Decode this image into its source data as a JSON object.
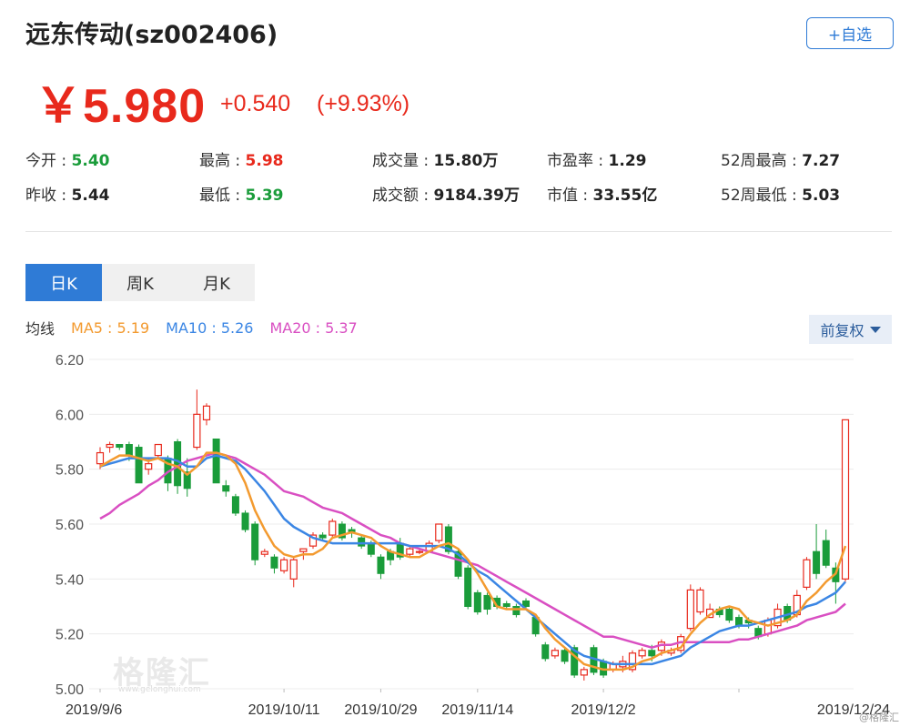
{
  "header": {
    "title": "远东传动(sz002406)",
    "add_button": "+自选"
  },
  "quote": {
    "price": "￥5.980",
    "change": "+0.540",
    "change_pct": "(+9.93%)"
  },
  "stats": {
    "open_label": "今开 : ",
    "open_value": "5.40",
    "prev_close_label": "昨收 : ",
    "prev_close_value": "5.44",
    "high_label": "最高 : ",
    "high_value": "5.98",
    "low_label": "最低 : ",
    "low_value": "5.39",
    "volume_label": "成交量 : ",
    "volume_value": "15.80万",
    "turnover_label": "成交额 : ",
    "turnover_value": "9184.39万",
    "pe_label": "市盈率 : ",
    "pe_value": "1.29",
    "mcap_label": "市值 : ",
    "mcap_value": "33.55亿",
    "wk52_high_label": "52周最高 : ",
    "wk52_high_value": "7.27",
    "wk52_low_label": "52周最低 : ",
    "wk52_low_value": "5.03"
  },
  "tabs": [
    {
      "label": "日K",
      "active": true
    },
    {
      "label": "周K",
      "active": false
    },
    {
      "label": "月K",
      "active": false
    }
  ],
  "ma_legend": {
    "label": "均线",
    "ma5": "MA5 : 5.19",
    "ma10": "MA10 : 5.26",
    "ma20": "MA20 : 5.37"
  },
  "adjust_button": "前复权",
  "watermark": {
    "text": "格隆汇",
    "url": "www.gelonghui.com",
    "credit": "@格隆汇"
  },
  "colors": {
    "up": "#e8291c",
    "down": "#1a9c3a",
    "accent": "#2f7bd6",
    "ma5": "#f39a2f",
    "ma10": "#3b86e4",
    "ma20": "#d94fc2"
  },
  "chart_data": {
    "type": "candlestick",
    "ylim": [
      5.0,
      6.2
    ],
    "y_ticks": [
      "6.20",
      "6.00",
      "5.80",
      "5.60",
      "5.40",
      "5.20",
      "5.00"
    ],
    "x_ticks": [
      "2019/9/6",
      "2019/10/11",
      "2019/10/29",
      "2019/11/14",
      "2019/12/2",
      "2019/12/24"
    ],
    "x_tick_index": [
      0,
      19,
      29,
      39,
      52,
      66
    ],
    "candles": [
      [
        5.82,
        5.86,
        5.88,
        5.8
      ],
      [
        5.88,
        5.89,
        5.9,
        5.86
      ],
      [
        5.89,
        5.88,
        5.89,
        5.87
      ],
      [
        5.89,
        5.85,
        5.9,
        5.83
      ],
      [
        5.88,
        5.75,
        5.89,
        5.75
      ],
      [
        5.8,
        5.82,
        5.84,
        5.78
      ],
      [
        5.85,
        5.89,
        5.89,
        5.84
      ],
      [
        5.84,
        5.75,
        5.85,
        5.72
      ],
      [
        5.9,
        5.74,
        5.91,
        5.71
      ],
      [
        5.79,
        5.73,
        5.84,
        5.7
      ],
      [
        5.88,
        6.0,
        6.09,
        5.87
      ],
      [
        5.98,
        6.03,
        6.04,
        5.96
      ],
      [
        5.91,
        5.75,
        5.91,
        5.75
      ],
      [
        5.74,
        5.72,
        5.76,
        5.7
      ],
      [
        5.7,
        5.64,
        5.71,
        5.63
      ],
      [
        5.64,
        5.58,
        5.65,
        5.57
      ],
      [
        5.6,
        5.47,
        5.61,
        5.45
      ],
      [
        5.49,
        5.5,
        5.51,
        5.48
      ],
      [
        5.48,
        5.44,
        5.49,
        5.42
      ],
      [
        5.43,
        5.47,
        5.48,
        5.42
      ],
      [
        5.4,
        5.47,
        5.48,
        5.37
      ],
      [
        5.5,
        5.51,
        5.51,
        5.47
      ],
      [
        5.52,
        5.56,
        5.57,
        5.51
      ],
      [
        5.56,
        5.55,
        5.57,
        5.54
      ],
      [
        5.56,
        5.61,
        5.62,
        5.55
      ],
      [
        5.6,
        5.55,
        5.61,
        5.54
      ],
      [
        5.58,
        5.57,
        5.59,
        5.55
      ],
      [
        5.55,
        5.52,
        5.56,
        5.51
      ],
      [
        5.53,
        5.49,
        5.54,
        5.48
      ],
      [
        5.48,
        5.42,
        5.49,
        5.4
      ],
      [
        5.5,
        5.47,
        5.51,
        5.45
      ],
      [
        5.53,
        5.48,
        5.55,
        5.47
      ],
      [
        5.49,
        5.51,
        5.52,
        5.48
      ],
      [
        5.5,
        5.5,
        5.51,
        5.49
      ],
      [
        5.5,
        5.53,
        5.54,
        5.5
      ],
      [
        5.54,
        5.6,
        5.6,
        5.53
      ],
      [
        5.59,
        5.5,
        5.6,
        5.49
      ],
      [
        5.5,
        5.41,
        5.51,
        5.4
      ],
      [
        5.44,
        5.3,
        5.45,
        5.29
      ],
      [
        5.35,
        5.28,
        5.36,
        5.27
      ],
      [
        5.34,
        5.29,
        5.35,
        5.27
      ],
      [
        5.33,
        5.3,
        5.34,
        5.29
      ],
      [
        5.31,
        5.3,
        5.32,
        5.29
      ],
      [
        5.3,
        5.27,
        5.31,
        5.26
      ],
      [
        5.32,
        5.3,
        5.33,
        5.29
      ],
      [
        5.26,
        5.2,
        5.27,
        5.19
      ],
      [
        5.16,
        5.11,
        5.17,
        5.1
      ],
      [
        5.12,
        5.14,
        5.15,
        5.11
      ],
      [
        5.14,
        5.1,
        5.15,
        5.09
      ],
      [
        5.15,
        5.05,
        5.16,
        5.04
      ],
      [
        5.05,
        5.07,
        5.08,
        5.03
      ],
      [
        5.15,
        5.06,
        5.16,
        5.05
      ],
      [
        5.1,
        5.05,
        5.11,
        5.04
      ],
      [
        5.07,
        5.09,
        5.1,
        5.06
      ],
      [
        5.08,
        5.1,
        5.12,
        5.06
      ],
      [
        5.07,
        5.13,
        5.14,
        5.06
      ],
      [
        5.12,
        5.14,
        5.15,
        5.11
      ],
      [
        5.14,
        5.12,
        5.16,
        5.1
      ],
      [
        5.14,
        5.17,
        5.18,
        5.12
      ],
      [
        5.13,
        5.14,
        5.15,
        5.12
      ],
      [
        5.14,
        5.19,
        5.2,
        5.13
      ],
      [
        5.22,
        5.36,
        5.38,
        5.21
      ],
      [
        5.28,
        5.36,
        5.37,
        5.27
      ],
      [
        5.26,
        5.29,
        5.31,
        5.26
      ],
      [
        5.29,
        5.27,
        5.3,
        5.26
      ],
      [
        5.29,
        5.25,
        5.3,
        5.24
      ],
      [
        5.26,
        5.23,
        5.27,
        5.22
      ],
      [
        5.25,
        5.24,
        5.26,
        5.22
      ],
      [
        5.22,
        5.19,
        5.23,
        5.18
      ],
      [
        5.2,
        5.25,
        5.26,
        5.19
      ],
      [
        5.23,
        5.29,
        5.31,
        5.22
      ],
      [
        5.3,
        5.25,
        5.31,
        5.24
      ],
      [
        5.27,
        5.34,
        5.36,
        5.26
      ],
      [
        5.37,
        5.47,
        5.48,
        5.36
      ],
      [
        5.5,
        5.42,
        5.6,
        5.4
      ],
      [
        5.54,
        5.45,
        5.58,
        5.44
      ],
      [
        5.44,
        5.39,
        5.46,
        5.31
      ],
      [
        5.4,
        5.98,
        5.98,
        5.39
      ]
    ],
    "ma5": [
      5.81,
      5.83,
      5.85,
      5.85,
      5.84,
      5.83,
      5.84,
      5.82,
      5.81,
      5.78,
      5.81,
      5.86,
      5.86,
      5.85,
      5.82,
      5.75,
      5.65,
      5.58,
      5.52,
      5.49,
      5.48,
      5.49,
      5.49,
      5.51,
      5.55,
      5.56,
      5.57,
      5.56,
      5.55,
      5.52,
      5.5,
      5.49,
      5.48,
      5.48,
      5.5,
      5.52,
      5.53,
      5.51,
      5.47,
      5.42,
      5.36,
      5.3,
      5.29,
      5.29,
      5.29,
      5.27,
      5.22,
      5.18,
      5.15,
      5.12,
      5.09,
      5.08,
      5.07,
      5.07,
      5.07,
      5.08,
      5.1,
      5.11,
      5.13,
      5.14,
      5.15,
      5.2,
      5.24,
      5.27,
      5.29,
      5.3,
      5.29,
      5.25,
      5.24,
      5.23,
      5.24,
      5.25,
      5.27,
      5.32,
      5.35,
      5.39,
      5.42,
      5.52
    ],
    "ma10": [
      5.81,
      5.82,
      5.83,
      5.84,
      5.84,
      5.84,
      5.84,
      5.84,
      5.83,
      5.81,
      5.81,
      5.84,
      5.85,
      5.84,
      5.83,
      5.8,
      5.76,
      5.72,
      5.67,
      5.62,
      5.59,
      5.57,
      5.55,
      5.54,
      5.53,
      5.53,
      5.53,
      5.53,
      5.53,
      5.53,
      5.53,
      5.53,
      5.52,
      5.52,
      5.52,
      5.52,
      5.51,
      5.49,
      5.46,
      5.43,
      5.41,
      5.38,
      5.35,
      5.32,
      5.29,
      5.26,
      5.23,
      5.2,
      5.17,
      5.14,
      5.12,
      5.11,
      5.1,
      5.09,
      5.09,
      5.09,
      5.09,
      5.09,
      5.1,
      5.11,
      5.12,
      5.15,
      5.17,
      5.19,
      5.21,
      5.22,
      5.23,
      5.23,
      5.24,
      5.25,
      5.26,
      5.27,
      5.28,
      5.3,
      5.31,
      5.33,
      5.35,
      5.39
    ],
    "ma20": [
      5.62,
      5.64,
      5.67,
      5.69,
      5.71,
      5.74,
      5.76,
      5.79,
      5.81,
      5.83,
      5.84,
      5.85,
      5.86,
      5.85,
      5.84,
      5.82,
      5.8,
      5.78,
      5.75,
      5.72,
      5.71,
      5.7,
      5.68,
      5.66,
      5.65,
      5.64,
      5.62,
      5.6,
      5.58,
      5.56,
      5.55,
      5.53,
      5.52,
      5.51,
      5.5,
      5.49,
      5.48,
      5.47,
      5.46,
      5.45,
      5.43,
      5.41,
      5.39,
      5.37,
      5.35,
      5.33,
      5.31,
      5.29,
      5.27,
      5.25,
      5.23,
      5.21,
      5.19,
      5.19,
      5.18,
      5.17,
      5.16,
      5.15,
      5.16,
      5.16,
      5.17,
      5.17,
      5.17,
      5.17,
      5.17,
      5.17,
      5.18,
      5.18,
      5.19,
      5.2,
      5.21,
      5.22,
      5.23,
      5.25,
      5.26,
      5.27,
      5.28,
      5.31
    ]
  }
}
